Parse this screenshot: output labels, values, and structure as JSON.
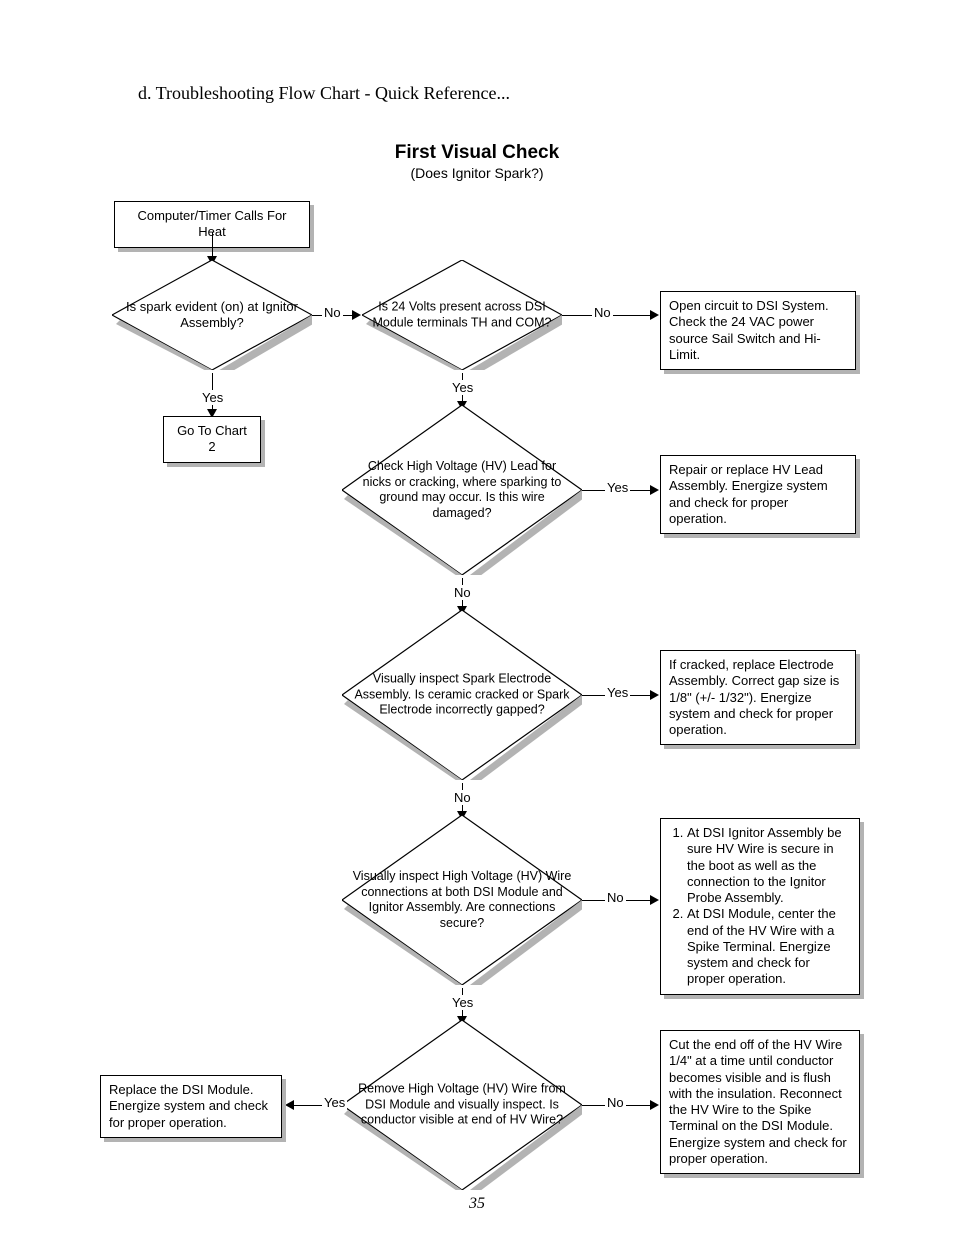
{
  "heading": "d.  Troubleshooting Flow Chart - Quick Reference...",
  "title": "First Visual Check",
  "subtitle": "(Does Ignitor Spark?)",
  "page_number": "35",
  "start": "Computer/Timer Calls For Heat",
  "d1": "Is spark evident (on) at Ignitor Assembly?",
  "d2": "Is 24 Volts present across DSI Module terminals TH and COM?",
  "d3": "Check High Voltage (HV) Lead for nicks or cracking, where sparking to ground may occur.  Is this wire damaged?",
  "d4": "Visually inspect Spark Electrode Assembly.  Is ceramic cracked or Spark Electrode incorrectly gapped?",
  "d5": "Visually inspect High Voltage (HV) Wire connections at both DSI Module and Ignitor Assembly. Are connections secure?",
  "d6": "Remove High Voltage (HV) Wire from DSI Module and visually inspect. Is conductor visible at end of HV Wire?",
  "b1": "Go To Chart 2",
  "b2": "Open circuit to DSI System. Check the 24 VAC power source Sail Switch and Hi-Limit.",
  "b3": "Repair or replace HV Lead Assembly. Energize system and check for proper operation.",
  "b4": "If cracked, replace Electrode Assembly.  Correct gap size is 1/8\" (+/- 1/32\"). Energize system and check for proper operation.",
  "b5_1": "At DSI Ignitor Assembly be sure HV Wire is secure in the boot as well as the connection to the Ignitor Probe Assembly.",
  "b5_2": "At DSI Module, center the end of the HV Wire with a Spike Terminal.  Energize system and check for proper operation.",
  "b6_yes": "Replace the DSI Module. Energize system and check for proper operation.",
  "b6_no": "Cut the end off of the HV Wire 1/4\" at a time until conductor becomes visible and is flush with the insulation. Reconnect the HV Wire to the Spike Terminal on the DSI Module. Energize system and check for proper operation.",
  "labels": {
    "yes": "Yes",
    "no": "No"
  }
}
